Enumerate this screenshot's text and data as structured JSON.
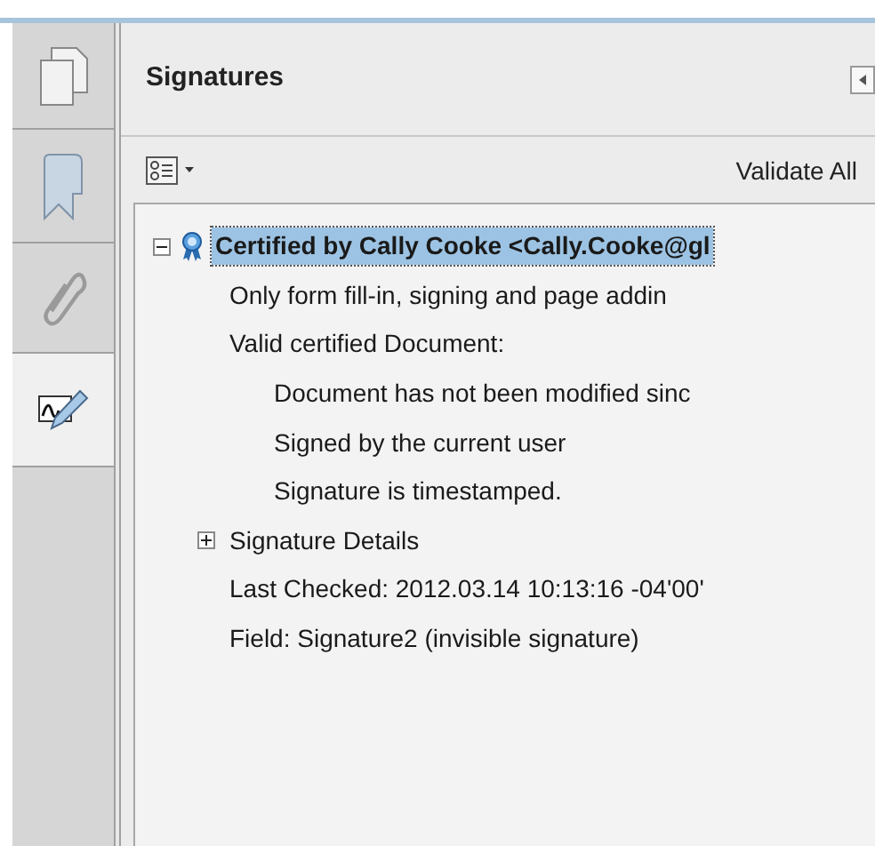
{
  "sidebar": {
    "tabs": [
      {
        "kind": "pages",
        "selected": false
      },
      {
        "kind": "bookmarks",
        "selected": false
      },
      {
        "kind": "attachments",
        "selected": false
      },
      {
        "kind": "signatures",
        "selected": true
      }
    ]
  },
  "panel": {
    "title": "Signatures",
    "toolbar": {
      "validate_button": "Validate All"
    },
    "tree": [
      {
        "kind": "group",
        "label": "Certified by Cally Cooke <Cally.Cooke@gl",
        "expanded": true,
        "selected": true,
        "children": [
          {
            "kind": "leaf",
            "label": "Only form fill-in, signing and page addin"
          },
          {
            "kind": "leaf",
            "label": "Valid certified Document:",
            "children": [
              {
                "kind": "leaf",
                "label": "Document has not been modified sinc"
              },
              {
                "kind": "leaf",
                "label": "Signed by the current user"
              },
              {
                "kind": "leaf",
                "label": "Signature is timestamped."
              }
            ]
          },
          {
            "kind": "group",
            "label": "Signature Details",
            "expanded": false,
            "selected": false
          },
          {
            "kind": "leaf",
            "label": "Last Checked: 2012.03.14 10:13:16 -04'00'"
          },
          {
            "kind": "leaf",
            "label": "Field: Signature2 (invisible signature)"
          }
        ]
      }
    ]
  }
}
